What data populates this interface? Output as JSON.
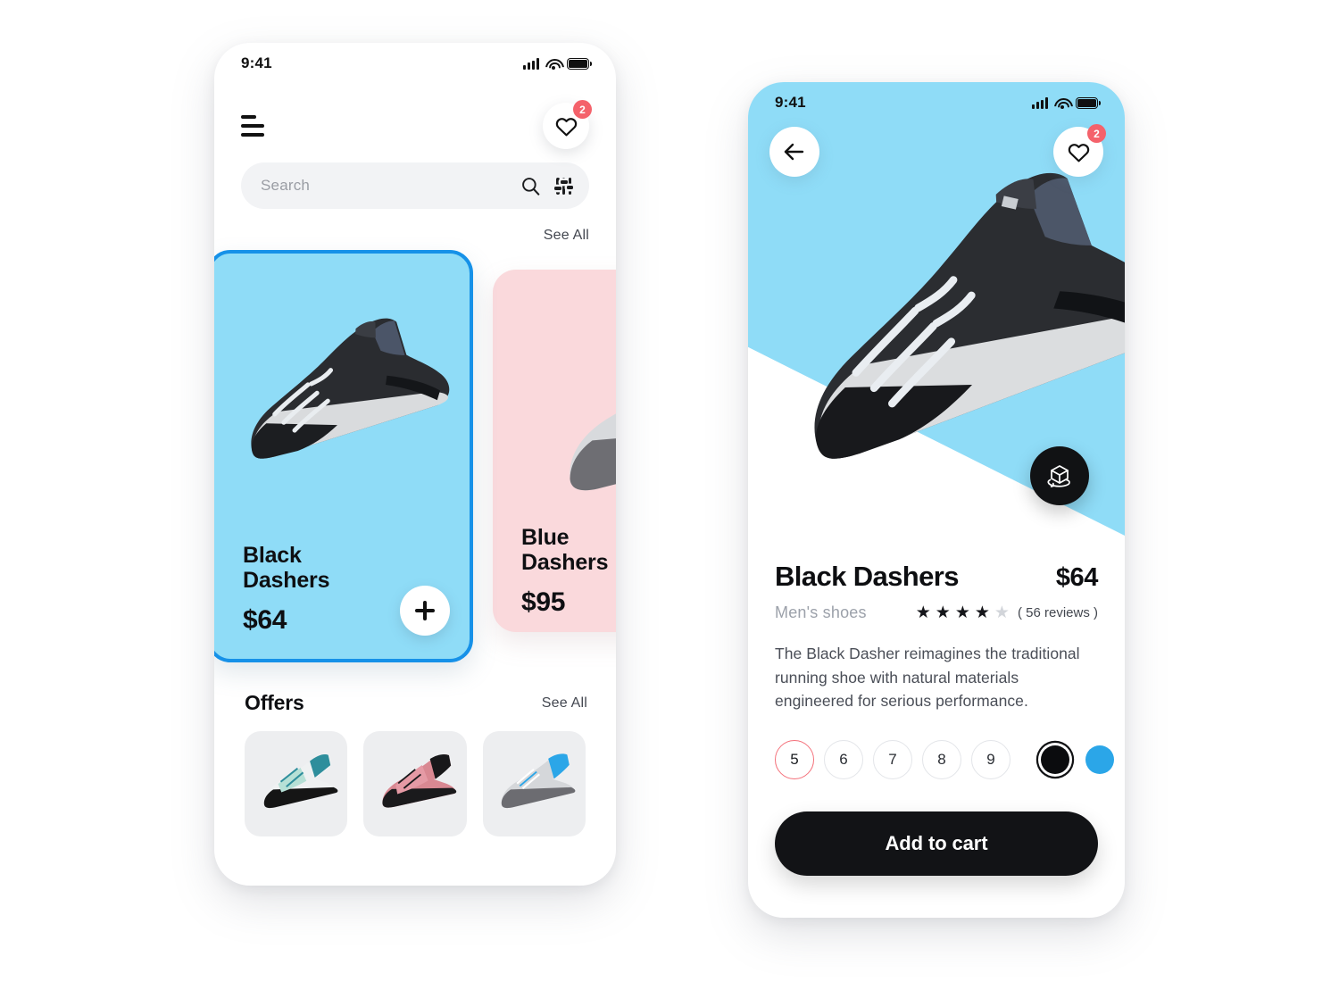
{
  "home": {
    "status": {
      "time": "9:41",
      "signal_icon": "cellular-signal-icon",
      "wifi_icon": "wifi-icon",
      "battery_icon": "battery-full-icon"
    },
    "menu_icon": "hamburger-menu-icon",
    "favorites": {
      "icon": "heart-icon",
      "badge": "2"
    },
    "search": {
      "placeholder": "Search",
      "search_icon": "search-icon",
      "filter_icon": "filter-sliders-icon"
    },
    "featured_see_all": "See All",
    "products": [
      {
        "name": "Black\nDashers",
        "price": "$64",
        "bg": "#8FDCF7",
        "add_icon": "plus-icon",
        "selected": true
      },
      {
        "name": "Blue\nDashers",
        "price": "$95",
        "bg": "#FAD9DC",
        "selected": false
      }
    ],
    "offers": {
      "title": "Offers",
      "see_all": "See All",
      "items": [
        {
          "name": "mint-white-sneaker"
        },
        {
          "name": "pink-black-sneaker"
        },
        {
          "name": "grey-blue-sneaker"
        }
      ]
    }
  },
  "detail": {
    "status": {
      "time": "9:41",
      "signal_icon": "cellular-signal-icon",
      "wifi_icon": "wifi-icon",
      "battery_icon": "battery-full-icon"
    },
    "back_icon": "arrow-left-icon",
    "favorites": {
      "icon": "heart-icon",
      "badge": "2"
    },
    "ar_icon": "3d-cube-rotate-icon",
    "hero_bg": "#8FDCF7",
    "product": {
      "name": "Black Dashers",
      "price": "$64",
      "category": "Men's shoes",
      "rating_filled": 4,
      "rating_total": 5,
      "reviews": "( 56 reviews )",
      "description": "The Black Dasher reimagines the traditional running shoe with natural materials engineered for serious performance."
    },
    "sizes": [
      {
        "label": "5",
        "selected": true
      },
      {
        "label": "6",
        "selected": false
      },
      {
        "label": "7",
        "selected": false
      },
      {
        "label": "8",
        "selected": false
      },
      {
        "label": "9",
        "selected": false
      }
    ],
    "colors": [
      {
        "name": "black-swatch",
        "hex": "#0B0C0E",
        "selected": true
      },
      {
        "name": "blue-swatch",
        "hex": "#2BA6E8",
        "selected": false
      }
    ],
    "cart_button": "Add to cart"
  },
  "theme": {
    "accent_blue": "#1691E8",
    "sky_blue": "#8FDCF7",
    "pink": "#FAD9DC",
    "badge_red": "#F4626B",
    "size_selected": "#F4707A",
    "dark": "#121316"
  }
}
